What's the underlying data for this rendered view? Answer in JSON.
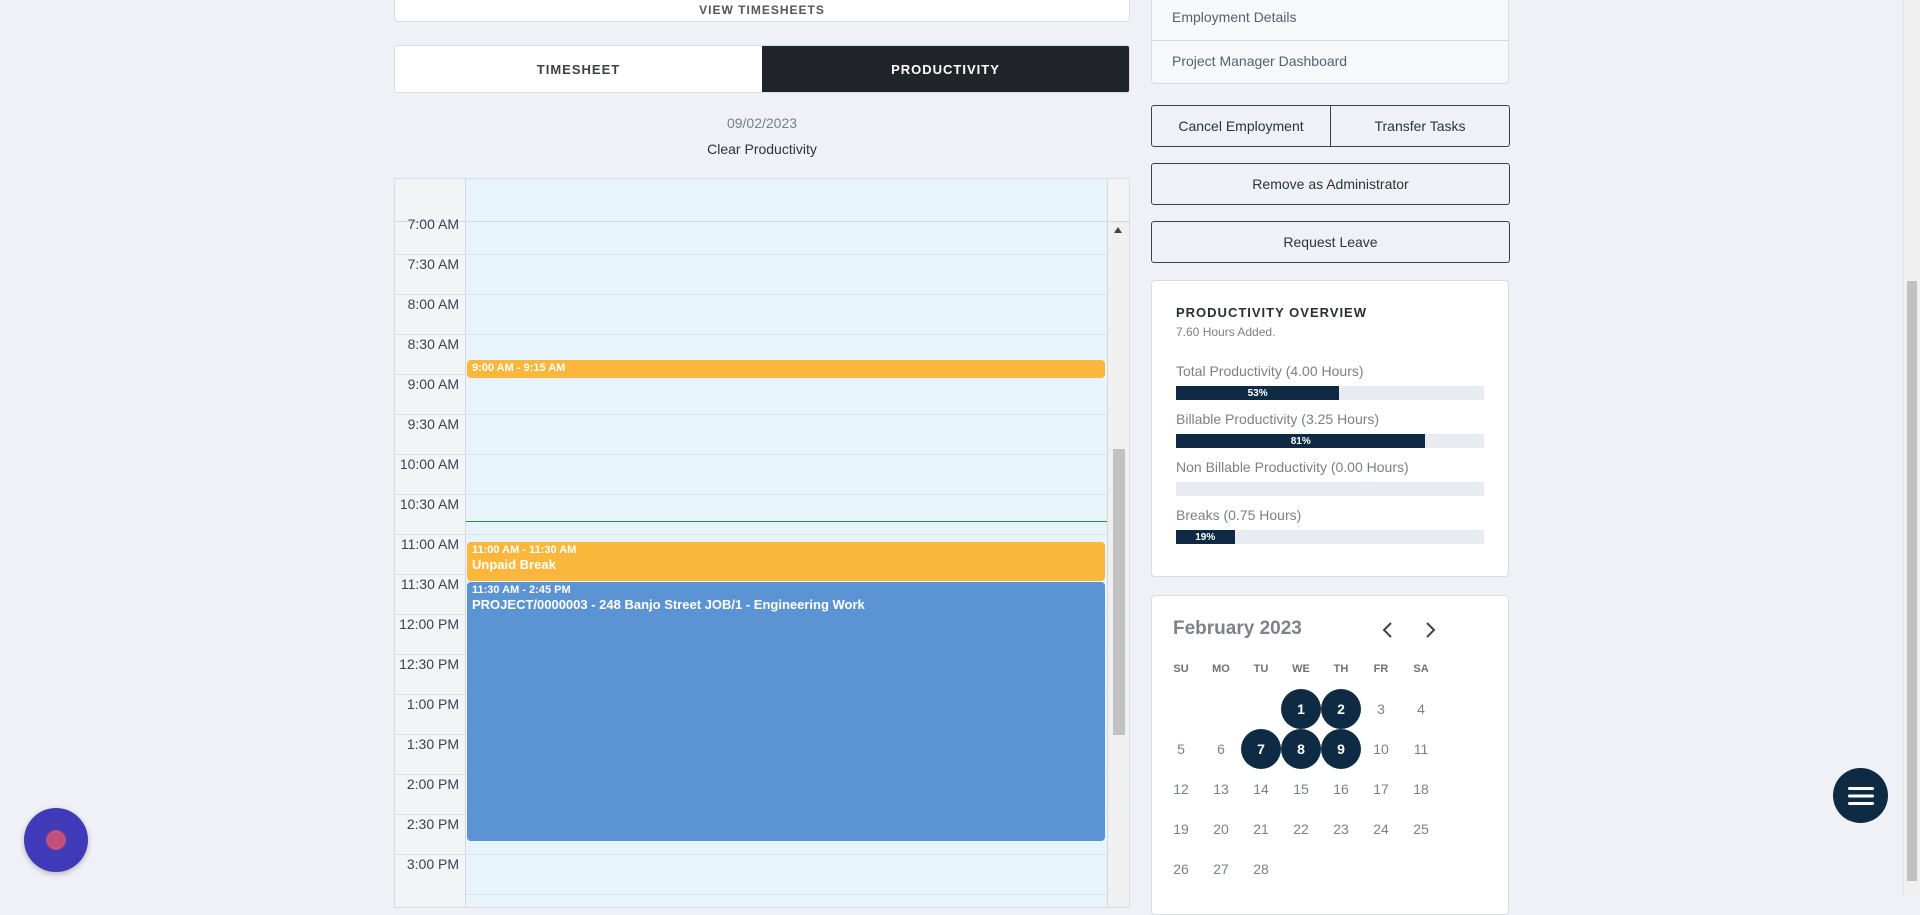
{
  "top_card": {
    "label": "VIEW TIMESHEETS"
  },
  "tabs": [
    {
      "label": "TIMESHEET",
      "active": false
    },
    {
      "label": "PRODUCTIVITY",
      "active": true
    }
  ],
  "date": "09/02/2023",
  "clear_label": "Clear Productivity",
  "calendar": {
    "times": [
      "7:00 AM",
      "7:30 AM",
      "8:00 AM",
      "8:30 AM",
      "9:00 AM",
      "9:30 AM",
      "10:00 AM",
      "10:30 AM",
      "11:00 AM",
      "11:30 AM",
      "12:00 PM",
      "12:30 PM",
      "1:00 PM",
      "1:30 PM",
      "2:00 PM",
      "2:30 PM",
      "3:00 PM"
    ],
    "events": [
      {
        "time": "9:00 AM - 9:15 AM",
        "name": "",
        "color": "#fbb63c"
      },
      {
        "time": "11:00 AM - 11:30 AM",
        "name": "Unpaid Break",
        "color": "#fbb63c"
      },
      {
        "time": "11:30 AM - 2:45 PM",
        "name": "PROJECT/0000003 - 248 Banjo Street JOB/1 - Engineering Work",
        "color": "#5b93d3"
      }
    ]
  },
  "side_menu": {
    "items": [
      "Employment Details",
      "Project Manager Dashboard"
    ]
  },
  "actions": {
    "cancel_employment": "Cancel Employment",
    "transfer_tasks": "Transfer Tasks",
    "remove_admin": "Remove as Administrator",
    "request_leave": "Request Leave"
  },
  "productivity": {
    "title": "PRODUCTIVITY OVERVIEW",
    "subtitle": "7.60 Hours Added.",
    "metrics": [
      {
        "label": "Total Productivity (4.00 Hours)",
        "percent": 53,
        "percent_label": "53%"
      },
      {
        "label": "Billable Productivity (3.25 Hours)",
        "percent": 81,
        "percent_label": "81%"
      },
      {
        "label": "Non Billable Productivity (0.00 Hours)",
        "percent": 0,
        "percent_label": ""
      },
      {
        "label": "Breaks (0.75 Hours)",
        "percent": 19,
        "percent_label": "19%"
      }
    ]
  },
  "mini_calendar": {
    "month": "February 2023",
    "weekdays": [
      "SU",
      "MO",
      "TU",
      "WE",
      "TH",
      "FR",
      "SA"
    ],
    "weeks": [
      [
        "",
        "",
        "",
        "1",
        "2",
        "3",
        "4"
      ],
      [
        "5",
        "6",
        "7",
        "8",
        "9",
        "10",
        "11"
      ],
      [
        "12",
        "13",
        "14",
        "15",
        "16",
        "17",
        "18"
      ],
      [
        "19",
        "20",
        "21",
        "22",
        "23",
        "24",
        "25"
      ],
      [
        "26",
        "27",
        "28",
        "",
        "",
        "",
        ""
      ]
    ],
    "selected": [
      "1",
      "2",
      "7",
      "8",
      "9"
    ]
  },
  "colors": {
    "dark": "#0f2b44",
    "accent_orange": "#fbb63c",
    "accent_blue": "#5b93d3",
    "tab_active": "#212429"
  }
}
